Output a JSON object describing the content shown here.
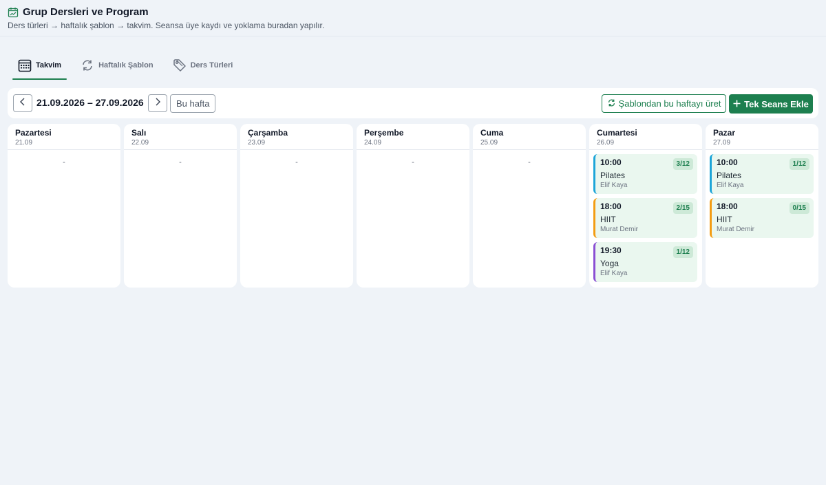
{
  "header": {
    "title": "Grup Dersleri ve Program",
    "subtitle": "Ders türleri → haftalık şablon → takvim. Seansa üye kaydı ve yoklama buradan yapılır."
  },
  "tabs": [
    {
      "label": "Takvim",
      "icon": "calendar-icon",
      "active": true
    },
    {
      "label": "Haftalık Şablon",
      "icon": "refresh-icon",
      "active": false
    },
    {
      "label": "Ders Türleri",
      "icon": "tag-icon",
      "active": false
    }
  ],
  "toolbar": {
    "date_range": "21.09.2026 – 27.09.2026",
    "this_week_label": "Bu hafta",
    "template_label": "Şablondan bu haftayı üret",
    "add_session_label": "Tek Seans Ekle"
  },
  "colors": {
    "accent": "#1d7f4f",
    "blue": "#1ca5d8",
    "orange": "#f39c12",
    "purple": "#8a4fd3"
  },
  "days": [
    {
      "name": "Pazartesi",
      "date": "21.09",
      "empty": "-"
    },
    {
      "name": "Salı",
      "date": "22.09",
      "empty": "-"
    },
    {
      "name": "Çarşamba",
      "date": "23.09",
      "empty": "-"
    },
    {
      "name": "Perşembe",
      "date": "24.09",
      "empty": "-"
    },
    {
      "name": "Cuma",
      "date": "25.09",
      "empty": "-"
    },
    {
      "name": "Cumartesi",
      "date": "26.09",
      "sessions": [
        {
          "time": "10:00",
          "name": "Pilates",
          "coach": "Elif Kaya",
          "capacity": "3/12"
        },
        {
          "time": "18:00",
          "name": "HIIT",
          "coach": "Murat Demir",
          "capacity": "2/15"
        },
        {
          "time": "19:30",
          "name": "Yoga",
          "coach": "Elif Kaya",
          "capacity": "1/12"
        }
      ]
    },
    {
      "name": "Pazar",
      "date": "27.09",
      "sessions": [
        {
          "time": "10:00",
          "name": "Pilates",
          "coach": "Elif Kaya",
          "capacity": "1/12"
        },
        {
          "time": "18:00",
          "name": "HIIT",
          "coach": "Murat Demir",
          "capacity": "0/15"
        }
      ]
    }
  ]
}
